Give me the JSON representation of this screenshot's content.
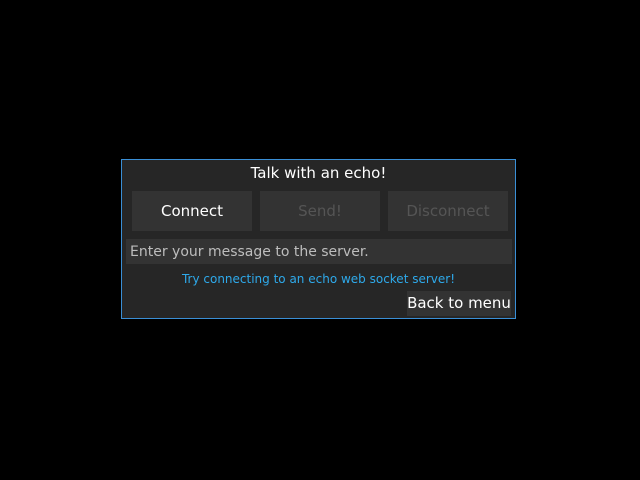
{
  "panel": {
    "title": "Talk with an echo!",
    "buttons": {
      "connect": "Connect",
      "send": "Send!",
      "disconnect": "Disconnect"
    },
    "message_input": {
      "value": "",
      "placeholder": "Enter your message to the server."
    },
    "status": "Try connecting to an echo web socket server!",
    "back_button": "Back to menu"
  },
  "colors": {
    "background": "#000000",
    "panel": "#262626",
    "panel_border": "#3a8fd6",
    "button": "#333333",
    "disabled_text": "#555555",
    "status_text": "#2ea9ea"
  }
}
